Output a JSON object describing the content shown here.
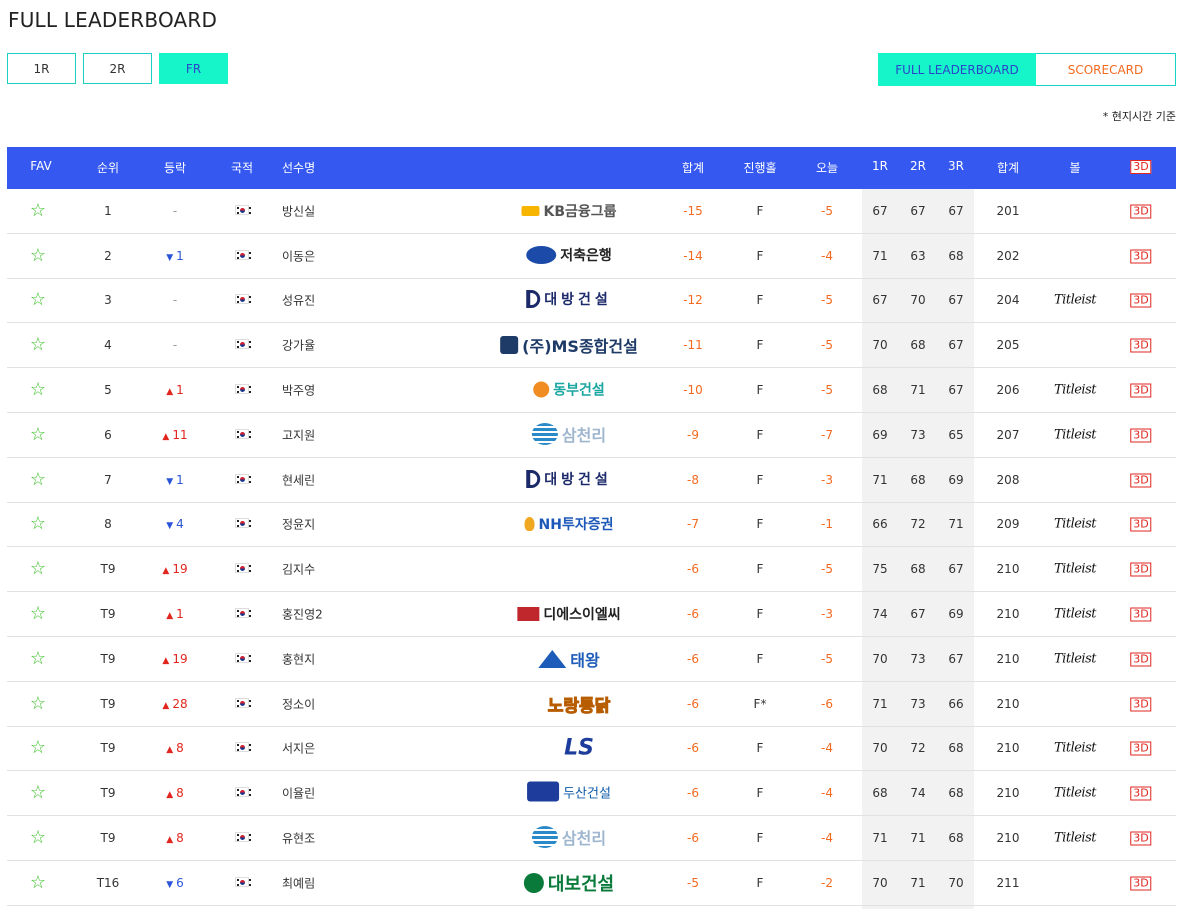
{
  "page": {
    "title": "FULL LEADERBOARD",
    "note": "* 현지시간 기준"
  },
  "round_tabs": [
    {
      "label": "1R",
      "active": false
    },
    {
      "label": "2R",
      "active": false
    },
    {
      "label": "FR",
      "active": true
    }
  ],
  "view_tabs": {
    "full": "FULL LEADERBOARD",
    "scorecard": "SCORECARD"
  },
  "headers": {
    "fav": "FAV",
    "rank": "순위",
    "move": "등락",
    "nation": "국적",
    "name": "선수명",
    "total": "합계",
    "hole": "진행홀",
    "today": "오늘",
    "r1": "1R",
    "r2": "2R",
    "r3": "3R",
    "sum": "합계",
    "ball": "볼",
    "view3d": "3D"
  },
  "colors": {
    "header_bg": "#3559f0",
    "accent": "#15f5c9",
    "up": "#e0261f",
    "down": "#2a55d8",
    "score": "#f26a21",
    "fav": "#3ec12b"
  },
  "rows": [
    {
      "rank": "1",
      "dir": "same",
      "move": "-",
      "name": "방신실",
      "sponsor": "KB금융그룹",
      "sp": "kb",
      "total": "-15",
      "hole": "F",
      "today": "-5",
      "r1": "67",
      "r2": "67",
      "r3": "67",
      "sum": "201",
      "ball": "",
      "view3d": "3D"
    },
    {
      "rank": "2",
      "dir": "down",
      "move": "1",
      "name": "이동은",
      "sponsor": "저축은행",
      "sp": "sbi",
      "total": "-14",
      "hole": "F",
      "today": "-4",
      "r1": "71",
      "r2": "63",
      "r3": "68",
      "sum": "202",
      "ball": "",
      "view3d": "3D"
    },
    {
      "rank": "3",
      "dir": "same",
      "move": "-",
      "name": "성유진",
      "sponsor": "대방건설",
      "sp": "daebang",
      "total": "-12",
      "hole": "F",
      "today": "-5",
      "r1": "67",
      "r2": "70",
      "r3": "67",
      "sum": "204",
      "ball": "Titleist",
      "view3d": "3D"
    },
    {
      "rank": "4",
      "dir": "same",
      "move": "-",
      "name": "강가율",
      "sponsor": "(주)MS종합건설",
      "sp": "ms",
      "total": "-11",
      "hole": "F",
      "today": "-5",
      "r1": "70",
      "r2": "68",
      "r3": "67",
      "sum": "205",
      "ball": "",
      "view3d": "3D"
    },
    {
      "rank": "5",
      "dir": "up",
      "move": "1",
      "name": "박주영",
      "sponsor": "동부건설",
      "sp": "dongbu",
      "total": "-10",
      "hole": "F",
      "today": "-5",
      "r1": "68",
      "r2": "71",
      "r3": "67",
      "sum": "206",
      "ball": "Titleist",
      "view3d": "3D"
    },
    {
      "rank": "6",
      "dir": "up",
      "move": "11",
      "name": "고지원",
      "sponsor": "삼천리",
      "sp": "samchully",
      "total": "-9",
      "hole": "F",
      "today": "-7",
      "r1": "69",
      "r2": "73",
      "r3": "65",
      "sum": "207",
      "ball": "Titleist",
      "view3d": "3D"
    },
    {
      "rank": "7",
      "dir": "down",
      "move": "1",
      "name": "현세린",
      "sponsor": "대방건설",
      "sp": "daebang",
      "total": "-8",
      "hole": "F",
      "today": "-3",
      "r1": "71",
      "r2": "68",
      "r3": "69",
      "sum": "208",
      "ball": "",
      "view3d": "3D"
    },
    {
      "rank": "8",
      "dir": "down",
      "move": "4",
      "name": "정윤지",
      "sponsor": "NH투자증권",
      "sp": "nh",
      "total": "-7",
      "hole": "F",
      "today": "-1",
      "r1": "66",
      "r2": "72",
      "r3": "71",
      "sum": "209",
      "ball": "Titleist",
      "view3d": "3D"
    },
    {
      "rank": "T9",
      "dir": "up",
      "move": "19",
      "name": "김지수",
      "sponsor": "",
      "sp": "",
      "total": "-6",
      "hole": "F",
      "today": "-5",
      "r1": "75",
      "r2": "68",
      "r3": "67",
      "sum": "210",
      "ball": "Titleist",
      "view3d": "3D"
    },
    {
      "rank": "T9",
      "dir": "up",
      "move": "1",
      "name": "홍진영2",
      "sponsor": "디에스이엘씨",
      "sp": "ds",
      "total": "-6",
      "hole": "F",
      "today": "-3",
      "r1": "74",
      "r2": "67",
      "r3": "69",
      "sum": "210",
      "ball": "Titleist",
      "view3d": "3D"
    },
    {
      "rank": "T9",
      "dir": "up",
      "move": "19",
      "name": "홍현지",
      "sponsor": "태왕",
      "sp": "taeyang",
      "total": "-6",
      "hole": "F",
      "today": "-5",
      "r1": "70",
      "r2": "73",
      "r3": "67",
      "sum": "210",
      "ball": "Titleist",
      "view3d": "3D"
    },
    {
      "rank": "T9",
      "dir": "up",
      "move": "28",
      "name": "정소이",
      "sponsor": "노랑통닭",
      "sp": "nojang",
      "total": "-6",
      "hole": "F*",
      "today": "-6",
      "r1": "71",
      "r2": "73",
      "r3": "66",
      "sum": "210",
      "ball": "",
      "view3d": "3D"
    },
    {
      "rank": "T9",
      "dir": "up",
      "move": "8",
      "name": "서지은",
      "sponsor": "LS",
      "sp": "ls",
      "total": "-6",
      "hole": "F",
      "today": "-4",
      "r1": "70",
      "r2": "72",
      "r3": "68",
      "sum": "210",
      "ball": "Titleist",
      "view3d": "3D"
    },
    {
      "rank": "T9",
      "dir": "up",
      "move": "8",
      "name": "이율린",
      "sponsor": "두산건설",
      "sp": "doosan",
      "total": "-6",
      "hole": "F",
      "today": "-4",
      "r1": "68",
      "r2": "74",
      "r3": "68",
      "sum": "210",
      "ball": "Titleist",
      "view3d": "3D"
    },
    {
      "rank": "T9",
      "dir": "up",
      "move": "8",
      "name": "유현조",
      "sponsor": "삼천리",
      "sp": "samchully",
      "total": "-6",
      "hole": "F",
      "today": "-4",
      "r1": "71",
      "r2": "71",
      "r3": "68",
      "sum": "210",
      "ball": "Titleist",
      "view3d": "3D"
    },
    {
      "rank": "T16",
      "dir": "down",
      "move": "6",
      "name": "최예림",
      "sponsor": "대보건설",
      "sp": "daebo",
      "total": "-5",
      "hole": "F",
      "today": "-2",
      "r1": "70",
      "r2": "71",
      "r3": "70",
      "sum": "211",
      "ball": "",
      "view3d": "3D"
    }
  ]
}
